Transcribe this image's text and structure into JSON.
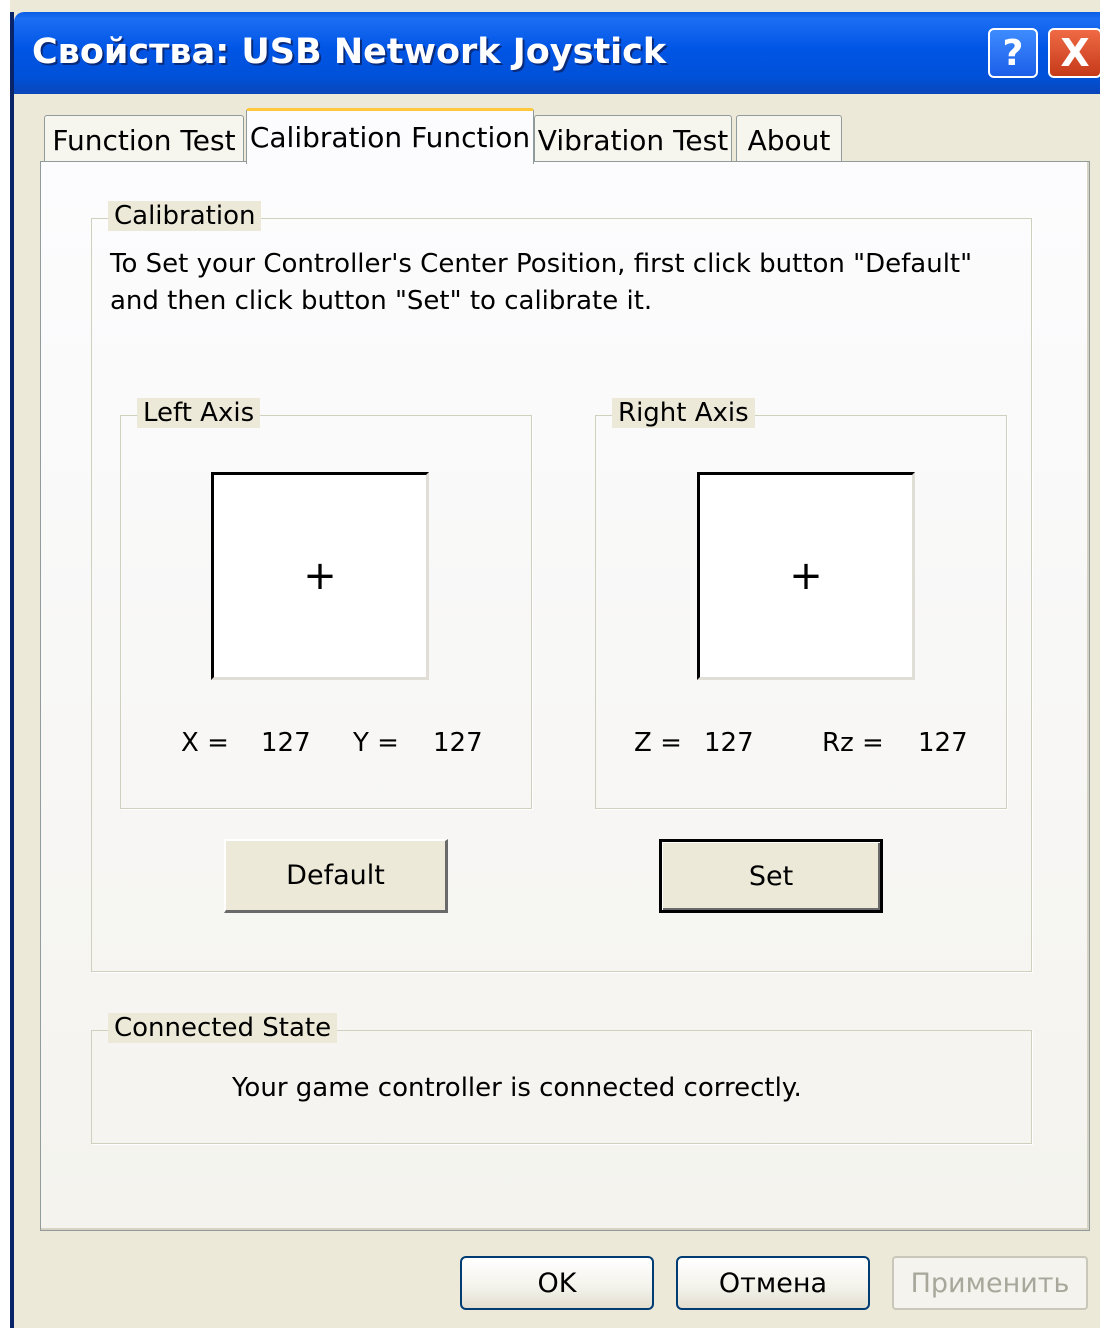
{
  "window": {
    "title": "Свойства: USB Network Joystick",
    "help_glyph": "?",
    "close_glyph": "X"
  },
  "tabs": [
    {
      "label": "Function Test",
      "active": false
    },
    {
      "label": "Calibration Function",
      "active": true
    },
    {
      "label": "Vibration Test",
      "active": false
    },
    {
      "label": "About",
      "active": false
    }
  ],
  "calibration": {
    "group_label": "Calibration",
    "instruction_line1": "To Set your Controller's  Center Position, first click button \"Default\"",
    "instruction_line2": "and then click button \"Set\" to calibrate it.",
    "left_axis": {
      "label": "Left Axis",
      "crosshair": "+",
      "x_label": "X =",
      "x_value": "127",
      "y_label": "Y =",
      "y_value": "127"
    },
    "right_axis": {
      "label": "Right Axis",
      "crosshair": "+",
      "z_label": "Z =",
      "z_value": "127",
      "rz_label": "Rz =",
      "rz_value": "127"
    },
    "default_button": "Default",
    "set_button": "Set"
  },
  "connected_state": {
    "group_label": "Connected State",
    "message": "Your game controller is connected correctly."
  },
  "footer": {
    "ok_label": "OK",
    "cancel_label": "Отмена",
    "apply_label": "Применить"
  },
  "colors": {
    "titlebar": "#0055e5",
    "active_tab_accent": "#ffc83c",
    "dialog_bg": "#ece9d8",
    "close_button": "#c63a1a"
  }
}
